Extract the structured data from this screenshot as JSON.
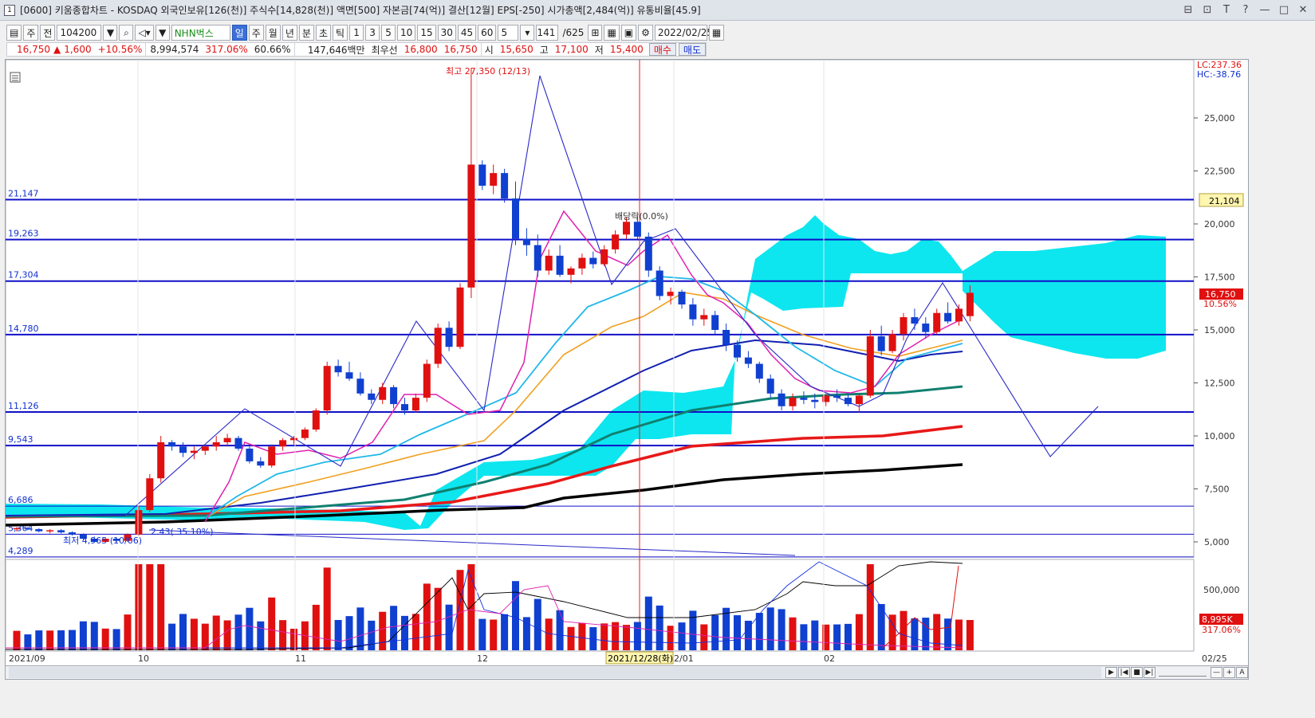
{
  "window": {
    "number": "1",
    "title": "[0600] 키움종합차트 - KOSDAQ 외국인보유[126(천)] 주식수[14,828(천)] 액면[500] 자본금[74(억)] 결산[12월] EPS[-250] 시가총액[2,484(억)] 유통비율[45.9]",
    "buttons": [
      "⊟",
      "⊡",
      "T",
      "?",
      "—",
      "□",
      "✕"
    ]
  },
  "toolbar": {
    "chart_type": "주",
    "prev_label": "전",
    "stock_code": "104200",
    "stock_name": "NHN벅스",
    "periods": [
      "일",
      "주",
      "월",
      "년",
      "분",
      "초",
      "틱"
    ],
    "selected_period": "일",
    "intervals": [
      "1",
      "3",
      "5",
      "10",
      "15",
      "30",
      "45",
      "60"
    ],
    "interval_value": "5",
    "count": "141",
    "total": "/625",
    "date": "2022/02/25"
  },
  "quote": {
    "price": "16,750",
    "arrow": "▲",
    "change": "1,600",
    "change_pct": "+10.56%",
    "volume": "8,994,574",
    "volume_ratio": "317.06%",
    "turnover": "60.66%",
    "amount": "147,646백만",
    "best_label": "최우선",
    "best_ask": "16,800",
    "best_bid": "16,750",
    "open_label": "시",
    "open": "15,650",
    "high_label": "고",
    "high": "17,100",
    "low_label": "저",
    "low": "15,400",
    "buy_label": "매수",
    "sell_label": "매도"
  },
  "chart": {
    "lc": "LC:237.36",
    "hc": "HC:-38.76",
    "price_ticks": [
      "25,000",
      "22,500",
      "20,000",
      "17,500",
      "15,000",
      "12,500",
      "10,000",
      "7,500",
      "5,000"
    ],
    "volume_ticks": [
      "500,000"
    ],
    "h_levels": [
      {
        "label": "21,147",
        "value": 21147
      },
      {
        "label": "19,263",
        "value": 19263
      },
      {
        "label": "17,304",
        "value": 17304
      },
      {
        "label": "14,780",
        "value": 14780
      },
      {
        "label": "11,126",
        "value": 11126
      },
      {
        "label": "9,543",
        "value": 9543
      },
      {
        "label": "6,686",
        "value": 6686
      },
      {
        "label": "5,364",
        "value": 5364
      },
      {
        "label": "4,289",
        "value": 4289
      }
    ],
    "right_badge_level": "21,104",
    "current_price": "16,750",
    "current_pct": "10.56%",
    "volume_badge": "8,995K",
    "volume_badge_pct": "317.06%",
    "annotations": {
      "high": "최고 27,350 (12/13)",
      "low": "최저 4,965 (10/06)",
      "dividend": "배당락(0.0%)",
      "trend": "2.43( 35.10%)"
    },
    "x_labels": [
      "2021/09",
      "10",
      "11",
      "12",
      "2021/12/28(화)",
      "2/01",
      "02",
      "02/25"
    ],
    "colors": {
      "up": "#e01010",
      "down": "#1040d0",
      "cloud": "#00e5ee",
      "level": "#1010c8"
    }
  },
  "scroll": {
    "controls": [
      "▶",
      "|◀",
      "■",
      "▶|",
      "—",
      "+",
      "A"
    ]
  }
}
